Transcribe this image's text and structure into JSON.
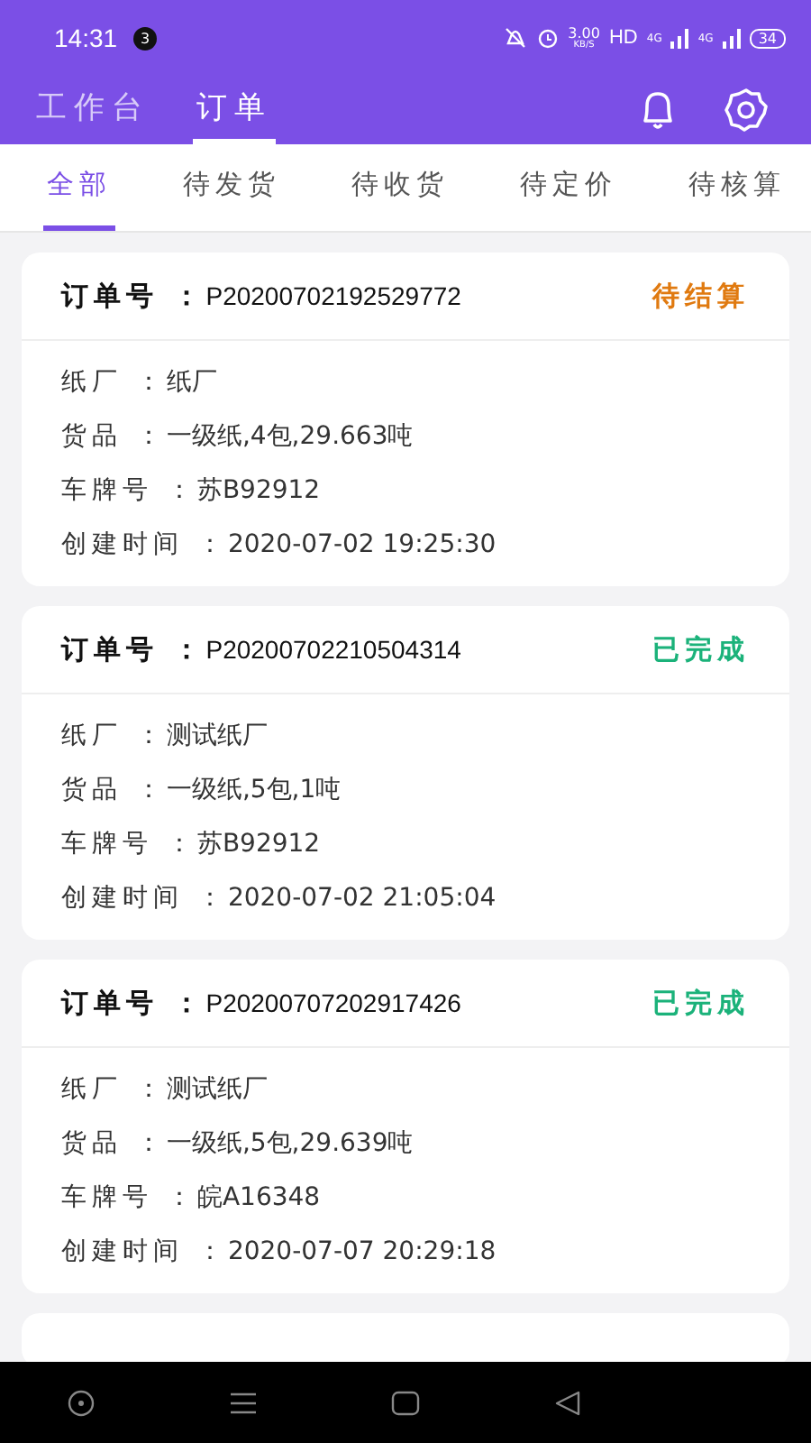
{
  "status_bar": {
    "time": "14:31",
    "badge": "3",
    "speed": "3.00",
    "speed_unit": "KB/S",
    "network": "HD",
    "signal_1": "4G",
    "signal_2": "4G",
    "battery": "34"
  },
  "header": {
    "tabs": [
      {
        "label": "工作台",
        "selected": false
      },
      {
        "label": "订单",
        "selected": true
      }
    ]
  },
  "filter_tabs": [
    {
      "label": "全部",
      "selected": true
    },
    {
      "label": "待发货",
      "selected": false
    },
    {
      "label": "待收货",
      "selected": false
    },
    {
      "label": "待定价",
      "selected": false
    },
    {
      "label": "待核算",
      "selected": false
    }
  ],
  "orders": [
    {
      "label": "订单号 ：",
      "number": "P20200702192529772",
      "status": "待结算",
      "kind": "pending",
      "fields": [
        {
          "label": "纸厂 ：",
          "value": "纸厂"
        },
        {
          "label": "货品 ：",
          "value": "一级纸,4包,29.663吨"
        },
        {
          "label": "车牌号 ：",
          "value": "苏B92912"
        },
        {
          "label": "创建时间 ：",
          "value": "2020-07-02 19:25:30"
        }
      ]
    },
    {
      "label": "订单号 ：",
      "number": "P20200702210504314",
      "status": "已完成",
      "kind": "done",
      "fields": [
        {
          "label": "纸厂 ：",
          "value": "测试纸厂"
        },
        {
          "label": "货品 ：",
          "value": "一级纸,5包,1吨"
        },
        {
          "label": "车牌号 ：",
          "value": "苏B92912"
        },
        {
          "label": "创建时间 ：",
          "value": "2020-07-02 21:05:04"
        }
      ]
    },
    {
      "label": "订单号 ：",
      "number": "P20200707202917426",
      "status": "已完成",
      "kind": "done",
      "fields": [
        {
          "label": "纸厂 ：",
          "value": "测试纸厂"
        },
        {
          "label": "货品 ：",
          "value": "一级纸,5包,29.639吨"
        },
        {
          "label": "车牌号 ：",
          "value": "皖A16348"
        },
        {
          "label": "创建时间 ：",
          "value": "2020-07-07 20:29:18"
        }
      ]
    }
  ]
}
